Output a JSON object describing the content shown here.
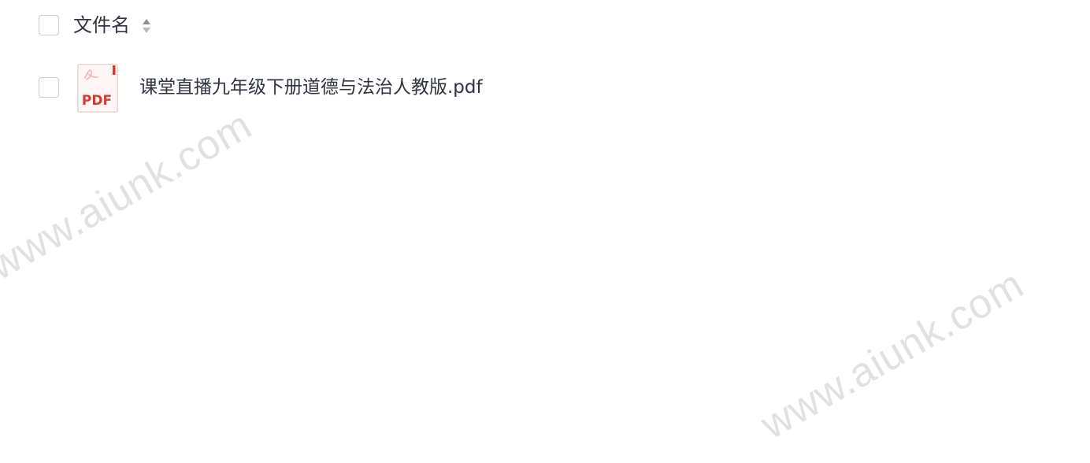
{
  "file_list": {
    "header": {
      "column_label": "文件名",
      "sort_icon": "sort-updown-icon"
    },
    "rows": [
      {
        "file_type": "PDF",
        "file_name": "课堂直播九年级下册道德与法治人教版.pdf"
      }
    ]
  },
  "watermark": {
    "text": "www.aiunk.com"
  },
  "colors": {
    "pdf_red": "#d63a33",
    "text": "#2f3440",
    "checkbox_border": "#c9ccd2"
  }
}
